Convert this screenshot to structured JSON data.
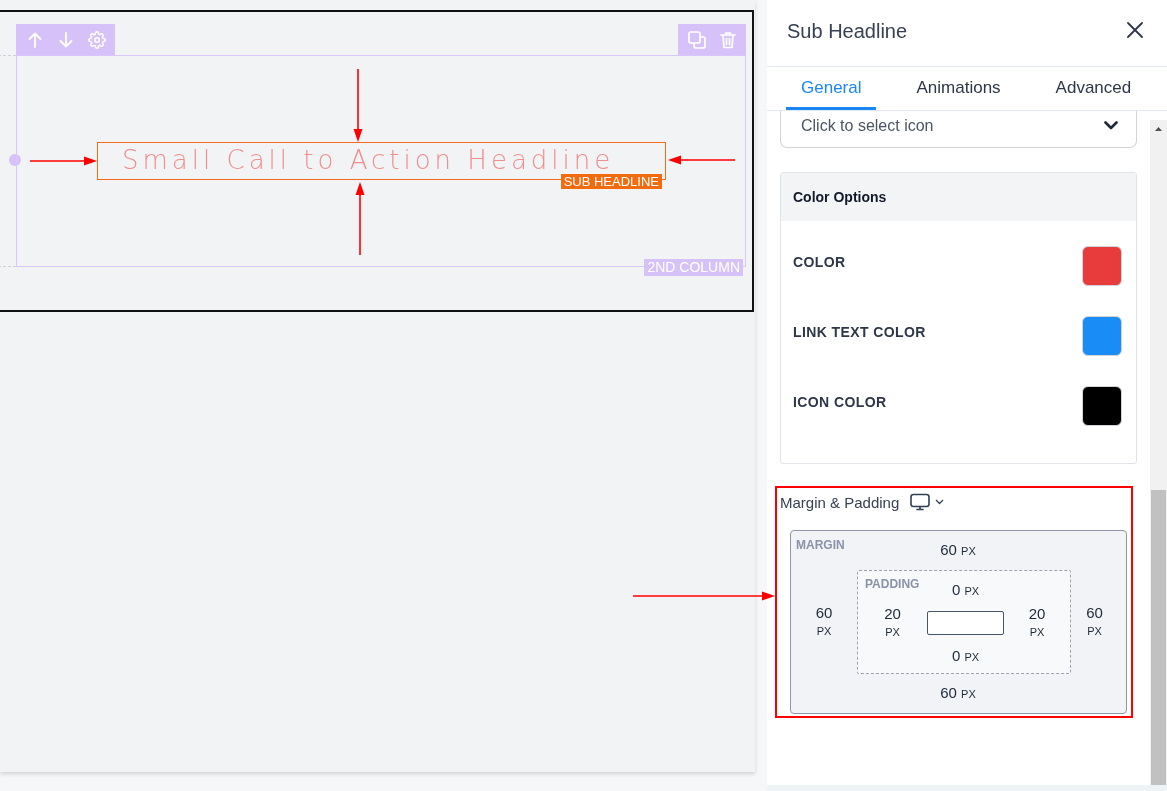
{
  "canvas": {
    "headline": "Small Call to Action Headline",
    "element_badge": "SUB HEADLINE",
    "column_badge": "2ND COLUMN"
  },
  "panel": {
    "title": "Sub Headline",
    "tabs": [
      {
        "label": "General",
        "selected": true
      },
      {
        "label": "Animations",
        "selected": false
      },
      {
        "label": "Advanced",
        "selected": false
      }
    ],
    "icon_field": {
      "placeholder": "Click to select icon"
    },
    "color_options": {
      "title": "Color Options",
      "items": [
        {
          "label": "COLOR",
          "color": "#e83c3c"
        },
        {
          "label": "LINK TEXT COLOR",
          "color": "#1a8cf5"
        },
        {
          "label": "ICON COLOR",
          "color": "#000000"
        }
      ]
    },
    "spacing": {
      "title": "Margin & Padding",
      "margin": {
        "label": "MARGIN",
        "top": {
          "value": "60",
          "unit": "PX"
        },
        "left": {
          "value": "60",
          "unit": "PX"
        },
        "right": {
          "value": "60",
          "unit": "PX"
        },
        "bottom": {
          "value": "60",
          "unit": "PX"
        }
      },
      "padding": {
        "label": "PADDING",
        "top": {
          "value": "0",
          "unit": "PX"
        },
        "left": {
          "value": "20",
          "unit": "PX"
        },
        "right": {
          "value": "20",
          "unit": "PX"
        },
        "bottom": {
          "value": "0",
          "unit": "PX"
        }
      }
    }
  }
}
